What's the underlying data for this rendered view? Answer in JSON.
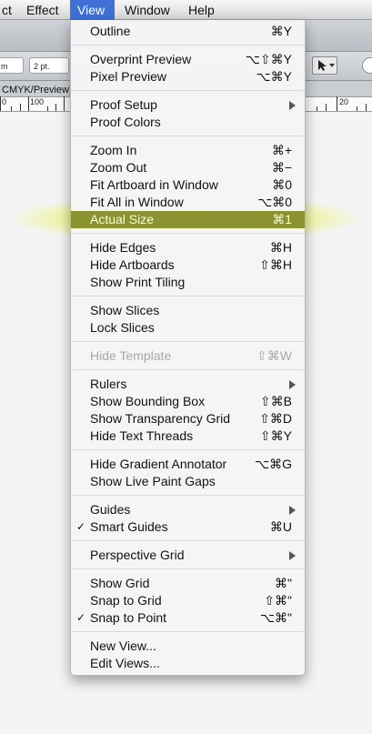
{
  "menubar": {
    "items": [
      {
        "label": "ct"
      },
      {
        "label": "Effect"
      },
      {
        "label": "View"
      },
      {
        "label": "Window"
      },
      {
        "label": "Help"
      }
    ]
  },
  "toolbar": {
    "field1": "m",
    "field2": "2 pt.",
    "doc_tab": "CMYK/Preview)"
  },
  "ruler": {
    "labels": [
      "0",
      "100",
      "20"
    ]
  },
  "menu": {
    "outline": {
      "label": "Outline",
      "shortcut": "⌘Y"
    },
    "overprint_preview": {
      "label": "Overprint Preview",
      "shortcut": "⌥⇧⌘Y"
    },
    "pixel_preview": {
      "label": "Pixel Preview",
      "shortcut": "⌥⌘Y"
    },
    "proof_setup": {
      "label": "Proof Setup"
    },
    "proof_colors": {
      "label": "Proof Colors"
    },
    "zoom_in": {
      "label": "Zoom In",
      "shortcut": "⌘+"
    },
    "zoom_out": {
      "label": "Zoom Out",
      "shortcut": "⌘−"
    },
    "fit_artboard": {
      "label": "Fit Artboard in Window",
      "shortcut": "⌘0"
    },
    "fit_all": {
      "label": "Fit All in Window",
      "shortcut": "⌥⌘0"
    },
    "actual_size": {
      "label": "Actual Size",
      "shortcut": "⌘1"
    },
    "hide_edges": {
      "label": "Hide Edges",
      "shortcut": "⌘H"
    },
    "hide_artboards": {
      "label": "Hide Artboards",
      "shortcut": "⇧⌘H"
    },
    "show_print_tiling": {
      "label": "Show Print Tiling"
    },
    "show_slices": {
      "label": "Show Slices"
    },
    "lock_slices": {
      "label": "Lock Slices"
    },
    "hide_template": {
      "label": "Hide Template",
      "shortcut": "⇧⌘W"
    },
    "rulers": {
      "label": "Rulers"
    },
    "show_bounding_box": {
      "label": "Show Bounding Box",
      "shortcut": "⇧⌘B"
    },
    "show_transparency_grid": {
      "label": "Show Transparency Grid",
      "shortcut": "⇧⌘D"
    },
    "hide_text_threads": {
      "label": "Hide Text Threads",
      "shortcut": "⇧⌘Y"
    },
    "hide_gradient_annotator": {
      "label": "Hide Gradient Annotator",
      "shortcut": "⌥⌘G"
    },
    "show_live_paint_gaps": {
      "label": "Show Live Paint Gaps"
    },
    "guides": {
      "label": "Guides"
    },
    "smart_guides": {
      "label": "Smart Guides",
      "shortcut": "⌘U",
      "check": "✓"
    },
    "perspective_grid": {
      "label": "Perspective Grid"
    },
    "show_grid": {
      "label": "Show Grid",
      "shortcut": "⌘\""
    },
    "snap_to_grid": {
      "label": "Snap to Grid",
      "shortcut": "⇧⌘\""
    },
    "snap_to_point": {
      "label": "Snap to Point",
      "shortcut": "⌥⌘\"",
      "check": "✓"
    },
    "new_view": {
      "label": "New View..."
    },
    "edit_views": {
      "label": "Edit Views..."
    }
  },
  "colors": {
    "menu_highlight": "#8b9330",
    "menubar_active": "#3f70d6",
    "glow": "#e6f53c"
  }
}
